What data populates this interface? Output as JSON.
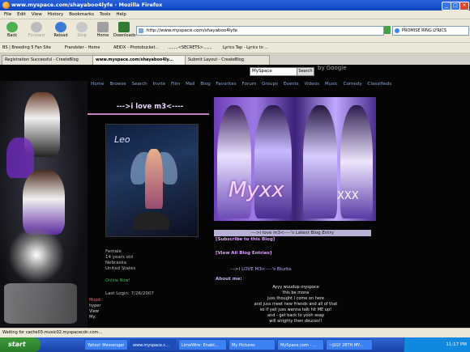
{
  "window": {
    "title": "www.myspace.com/shayaboo4lyfe - Mozilla Firefox"
  },
  "menu": [
    "File",
    "Edit",
    "View",
    "History",
    "Bookmarks",
    "Tools",
    "Help"
  ],
  "toolbar": {
    "back": "Back",
    "forward": "Forward",
    "reload": "Reload",
    "stop": "Stop",
    "home": "Home",
    "downloads": "Downloads"
  },
  "url": "http://www.myspace.com/shayaboo4lyfe",
  "search_box": "PROMISE RING LYRICS",
  "bookmarks": [
    "BS | Breeding 5 Fan Site",
    "Frandster - Home",
    "AEIDX - Photobucket...",
    ".,.,.,.,<SECRETS>.,.,.,.",
    "Lyrics Tap - Lyrics to ..."
  ],
  "tabs": [
    "Registration Successful - CreateBlog",
    "www.myspace.com/shayaboo4ly...",
    "Submit Layout - CreateBlog"
  ],
  "page": {
    "ms_search_value": "MySpace",
    "ms_search_button": "Search",
    "google_label": "by Google",
    "nav": [
      "Home",
      "Browse",
      "Search",
      "Invite",
      "Film",
      "Mail",
      "Blog",
      "Favorites",
      "Forum",
      "Groups",
      "Events",
      "Videos",
      "Music",
      "Comedy",
      "Classifieds"
    ],
    "profile_heading": "--->i love m3<----",
    "pic_caption": "Leo",
    "info_lines": [
      "Female",
      "14 years old",
      "Nebraska",
      "United States"
    ],
    "online": "Online Now!",
    "last_login": "Last Login: 7/26/2007",
    "mood_label": "Mood:",
    "mood_value": "hyper",
    "view_label": "View",
    "my_label": "My:",
    "banner_text": "Myxx",
    "banner_xxx": "XXX",
    "latest_blog": "--->i love m3<----'s Latest Blog Entry",
    "subscribe": "[Subscribe to this Blog]",
    "view_blogs": "[View All Blog Entries]",
    "blurbs": "--->I LOVE M3<----'s Blurbs",
    "about_me": "About me:",
    "about_lines": [
      "Ayyy wuudup myspace",
      "this be mona",
      "juss thought i come on here",
      "and juss meet new friends and all of that",
      "so if yall juss wanna talk hit ME up!",
      "and - get back to yooh asap",
      "will alrighty then deuces!!"
    ]
  },
  "status": "Waiting for cache03-music02.myspacecdn.com...",
  "taskbar": {
    "start": "start",
    "buttons": [
      "Yahoo! Messenger",
      "www.myspace.c...",
      "LimeWire: Enabl...",
      "My Pictures",
      "MySpace.com - ...",
      "~JULY 28TH MY..."
    ],
    "clock": "11:17 PM"
  },
  "colors": {
    "page_bg": "#050505",
    "accent": "#c0a9ff",
    "taskbar": "#245edb"
  }
}
